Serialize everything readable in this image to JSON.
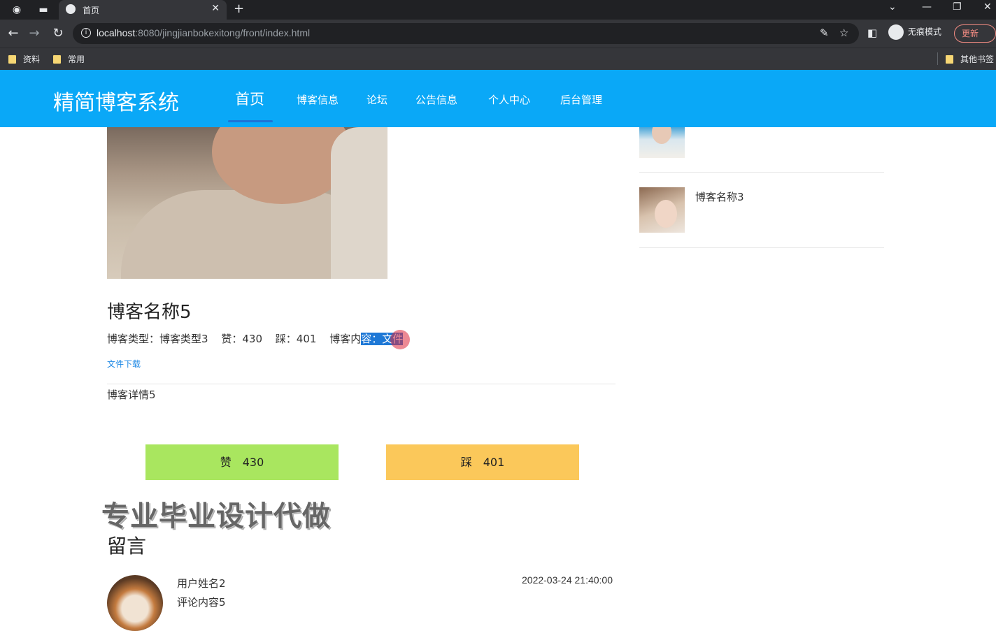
{
  "browser": {
    "tab_title": "首页",
    "url_host": "localhost",
    "url_rest": ":8080/jingjianbokexitong/front/index.html",
    "incognito_label": "无痕模式",
    "update_label": "更新",
    "bookmarks": [
      "资料",
      "常用"
    ],
    "other_bookmarks": "其他书签"
  },
  "site": {
    "logo": "精简博客系统",
    "nav": [
      "首页",
      "博客信息",
      "论坛",
      "公告信息",
      "个人中心",
      "后台管理"
    ]
  },
  "blog": {
    "title": "博客名称5",
    "type_label": "博客类型：",
    "type_value": "博客类型3",
    "like_label": "赞：",
    "like_value": "430",
    "dislike_label": "踩：",
    "dislike_value": "401",
    "content_label_pre": "博客内",
    "content_label_sel": "容：",
    "content_value": "文件",
    "download": "文件下载",
    "detail": "博客详情5",
    "like_button": "赞　430",
    "dislike_button": "踩　401"
  },
  "watermark": "专业毕业设计代做",
  "comments": {
    "title": "留言",
    "items": [
      {
        "user": "用户姓名2",
        "content": "评论内容5",
        "time": "2022-03-24 21:40:00"
      }
    ]
  },
  "sidebar": {
    "items": [
      {
        "name": ""
      },
      {
        "name": "博客名称3"
      }
    ]
  }
}
